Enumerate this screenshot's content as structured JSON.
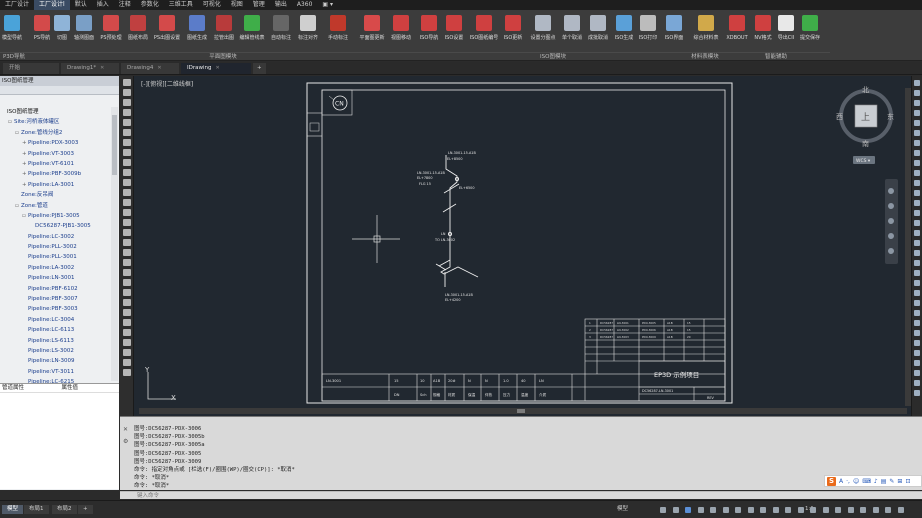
{
  "menu": [
    "工厂设计",
    "工厂设计l",
    "默认",
    "插入",
    "注释",
    "参数化",
    "三维工具",
    "可视化",
    "视图",
    "管理",
    "输出",
    "A360",
    "▣ ▾"
  ],
  "ribbon": {
    "buttons": [
      {
        "label": "模型导航",
        "color": "#4aa3d9"
      },
      {
        "label": "PS导航",
        "color": "#d34a4a"
      },
      {
        "label": "切图",
        "color": "#8fb4d8"
      },
      {
        "label": "轴测图面",
        "color": "#7a9fc6"
      },
      {
        "label": "PS预处理",
        "color": "#d34a4a"
      },
      {
        "label": "图纸布局",
        "color": "#c04040"
      },
      {
        "label": "PS出图设置",
        "color": "#d34a4a"
      },
      {
        "label": "图纸生成",
        "color": "#5b7cc9"
      },
      {
        "label": "拉管出图",
        "color": "#b83b3b"
      },
      {
        "label": "编辑管线表",
        "color": "#3fae49"
      },
      {
        "label": "自动标注",
        "color": "#666"
      },
      {
        "label": "标注对齐",
        "color": "#cfcfcf"
      },
      {
        "label": "手动标注",
        "color": "#c0392b"
      },
      {
        "label": "平面图更新",
        "color": "#d84a4a"
      },
      {
        "label": "视图移动",
        "color": "#cf4040"
      },
      {
        "label": "ISO导航",
        "color": "#cf4040"
      },
      {
        "label": "ISO设置",
        "color": "#cf4040"
      },
      {
        "label": "ISO图纸编号",
        "color": "#cf4040"
      },
      {
        "label": "ISO更新",
        "color": "#cf4040"
      },
      {
        "label": "设置分图点",
        "color": "#b0b8c4"
      },
      {
        "label": "单个取消",
        "color": "#b0b8c4"
      },
      {
        "label": "成批取消",
        "color": "#b0b8c4"
      },
      {
        "label": "ISO生成",
        "color": "#5aa0d8"
      },
      {
        "label": "ISO打印",
        "color": "#bcbcbc"
      },
      {
        "label": "ISO界面",
        "color": "#7aa7d6"
      },
      {
        "label": "综合材料表",
        "color": "#d1a94a"
      },
      {
        "label": "XDBOUT",
        "color": "#cf4040"
      },
      {
        "label": "NV格式",
        "color": "#cf4040"
      },
      {
        "label": "导出CII",
        "color": "#e8e8e8"
      },
      {
        "label": "提交保存",
        "color": "#3fae49"
      }
    ],
    "groups": [
      "P3D导航",
      "平面图模块",
      "ISO图模块",
      "材料表模块",
      "智能辅助"
    ]
  },
  "tabs": [
    {
      "label": "开始"
    },
    {
      "label": "Drawing1*"
    },
    {
      "label": "Drawing4"
    },
    {
      "label": "IDrawing"
    }
  ],
  "left_panel": {
    "header": "ISO图纸管理",
    "tree": [
      {
        "level": 0,
        "pm": "",
        "text": "ISO图纸管理"
      },
      {
        "level": 1,
        "pm": "▫",
        "text": "Site:河桥液体罐区"
      },
      {
        "level": 2,
        "pm": "▫",
        "text": "Zone:管线分组2"
      },
      {
        "level": 3,
        "pm": "+",
        "text": "Pipeline:PDX-3003"
      },
      {
        "level": 3,
        "pm": "+",
        "text": "Pipeline:VT-3003"
      },
      {
        "level": 3,
        "pm": "+",
        "text": "Pipeline:VT-6101"
      },
      {
        "level": 3,
        "pm": "+",
        "text": "Pipeline:PBF-3009b"
      },
      {
        "level": 3,
        "pm": "+",
        "text": "Pipeline:LA-3001"
      },
      {
        "level": 2,
        "pm": "",
        "text": "Zone:反吊阀"
      },
      {
        "level": 2,
        "pm": "▫",
        "text": "Zone:管道"
      },
      {
        "level": 3,
        "pm": "▫",
        "text": "Pipeline:PJB1-3005"
      },
      {
        "level": 4,
        "pm": "",
        "text": "DC56287-PJB1-3005"
      },
      {
        "level": 3,
        "pm": "",
        "text": "Pipeline:LC-3002"
      },
      {
        "level": 3,
        "pm": "",
        "text": "Pipeline:PLL-3002"
      },
      {
        "level": 3,
        "pm": "",
        "text": "Pipeline:PLL-3001"
      },
      {
        "level": 3,
        "pm": "",
        "text": "Pipeline:LA-3002"
      },
      {
        "level": 3,
        "pm": "",
        "text": "Pipeline:LN-3001"
      },
      {
        "level": 3,
        "pm": "",
        "text": "Pipeline:PBF-6102"
      },
      {
        "level": 3,
        "pm": "",
        "text": "Pipeline:PBF-3007"
      },
      {
        "level": 3,
        "pm": "",
        "text": "Pipeline:PBF-3003"
      },
      {
        "level": 3,
        "pm": "",
        "text": "Pipeline:LC-3004"
      },
      {
        "level": 3,
        "pm": "",
        "text": "Pipeline:LC-6113"
      },
      {
        "level": 3,
        "pm": "",
        "text": "Pipeline:LS-6113"
      },
      {
        "level": 3,
        "pm": "",
        "text": "Pipeline:LS-3002"
      },
      {
        "level": 3,
        "pm": "",
        "text": "Pipeline:LN-3009"
      },
      {
        "level": 3,
        "pm": "",
        "text": "Pipeline:VT-3011"
      },
      {
        "level": 3,
        "pm": "",
        "text": "Pipeline:LC-6215"
      }
    ],
    "props_header": [
      "管道属性",
      "属性值"
    ]
  },
  "canvas": {
    "viewport_label": "[-][俯视][二维线框]",
    "compass": {
      "north": "北",
      "south": "南",
      "east": "东",
      "west": "西",
      "center": "上",
      "wcs": "WCS ▾"
    },
    "cn_label": "CN",
    "title_block_text": "EP3D 示例项目",
    "dwg_no": "DC56287-LN-3001",
    "rev_label": "REV",
    "line_tag": "LN-3001",
    "titles": {
      "c1": "DN",
      "c2": "Sch",
      "c3": "规格",
      "c4": "材质",
      "c5": "保温",
      "c6": "伴热",
      "c7": "压力",
      "c8": "温度",
      "c9": "介质",
      "v1": "15",
      "v2": "10",
      "v3": "A1B",
      "v4": "20#",
      "v5": "N",
      "v6": "N",
      "v7": "1.0",
      "v8": "40",
      "v9": "LN"
    },
    "ucs": {
      "x": "X",
      "y": "Y"
    }
  },
  "command": {
    "history": [
      "图号:DC56287-PDX-3006",
      "图号:DC56287-PDX-3005b",
      "图号:DC56287-PDX-3005a",
      "图号:DC56287-PDX-3005",
      "图号:DC56287-PDX-3009",
      "命令: 指定对角点或 [栏选(F)/圈围(WP)/圈交(CP)]: *取消*",
      "命令: *取消*",
      "命令: *取消*"
    ],
    "placeholder": "键入命令"
  },
  "status": {
    "layout_tabs": [
      "模型",
      "布局1",
      "布局2"
    ],
    "model_label": "模型",
    "scale": "1:1",
    "ime": [
      "S",
      "A",
      "·,",
      "☺",
      "⌨",
      "♪",
      "▤",
      "✎",
      "⊞",
      "⊡"
    ]
  }
}
